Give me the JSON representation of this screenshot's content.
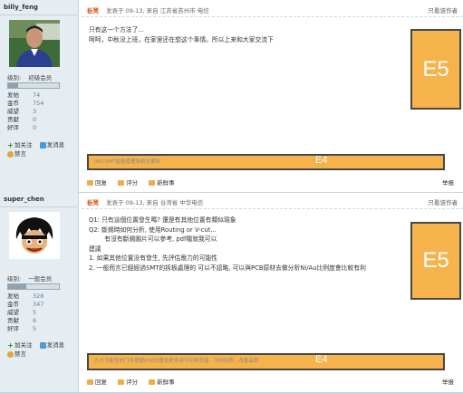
{
  "posts": [
    {
      "username": "billy_feng",
      "level_label": "级别:",
      "level_name": "初级会员",
      "level_progress": 0.2,
      "stats": [
        {
          "label": "发帖",
          "value": "74"
        },
        {
          "label": "金币",
          "value": "754"
        },
        {
          "label": "威望",
          "value": "3"
        },
        {
          "label": "贡献",
          "value": "0"
        },
        {
          "label": "好评",
          "value": "0"
        }
      ],
      "actions": [
        "加关注",
        "发消息",
        "禁言"
      ],
      "author": "板凳",
      "meta": "发表于 09-13, 来自 江苏省苏州市 电信",
      "view_only": "只看该作者",
      "body": [
        "只有这一个方法了...",
        "呵呵，中秋没上班，在家里还在想这个事情。所以上来和大家交流下"
      ],
      "e5_label": "E5",
      "signature": "IMS-SMT智能管理系统方案网",
      "e4_label": "E4",
      "footer": [
        "回复",
        "评分",
        "新鲜事"
      ],
      "report": "举报"
    },
    {
      "username": "super_chen",
      "level_label": "级别:",
      "level_name": "一般会员",
      "level_progress": 0.35,
      "stats": [
        {
          "label": "发帖",
          "value": "328"
        },
        {
          "label": "金币",
          "value": "347"
        },
        {
          "label": "威望",
          "value": "5"
        },
        {
          "label": "贡献",
          "value": "6"
        },
        {
          "label": "好评",
          "value": "5"
        }
      ],
      "actions": [
        "加关注",
        "发消息",
        "禁言"
      ],
      "author": "板凳",
      "meta": "发表于 09-13, 来自 台湾省 中华电信",
      "view_only": "只看该作者",
      "body": [
        "Q1: 只有這個位置發生嗎? 還是有其他位置有類似現象",
        "Q2: 斷錫時如何分析, 使用Routing or V-cut...",
        "        有沒有斷錫圖片可以參考, pdf檔就我可以",
        "建議",
        "1. 如果其他位置没有發生, 先評估應力的可能性",
        "2. 一般而言已經經過SMT的拆板處理的 可以不認略, 可以與PCB原材去做分析Ni/Au比例度會比較有利"
      ],
      "e5_label": "E5",
      "signature": "九方节能型的门可根据PCB设置和更多调节印刷范围，节约培养，改善品质",
      "e4_label": "E4",
      "footer": [
        "回复",
        "评分",
        "新鲜事"
      ],
      "report": "举报"
    }
  ]
}
